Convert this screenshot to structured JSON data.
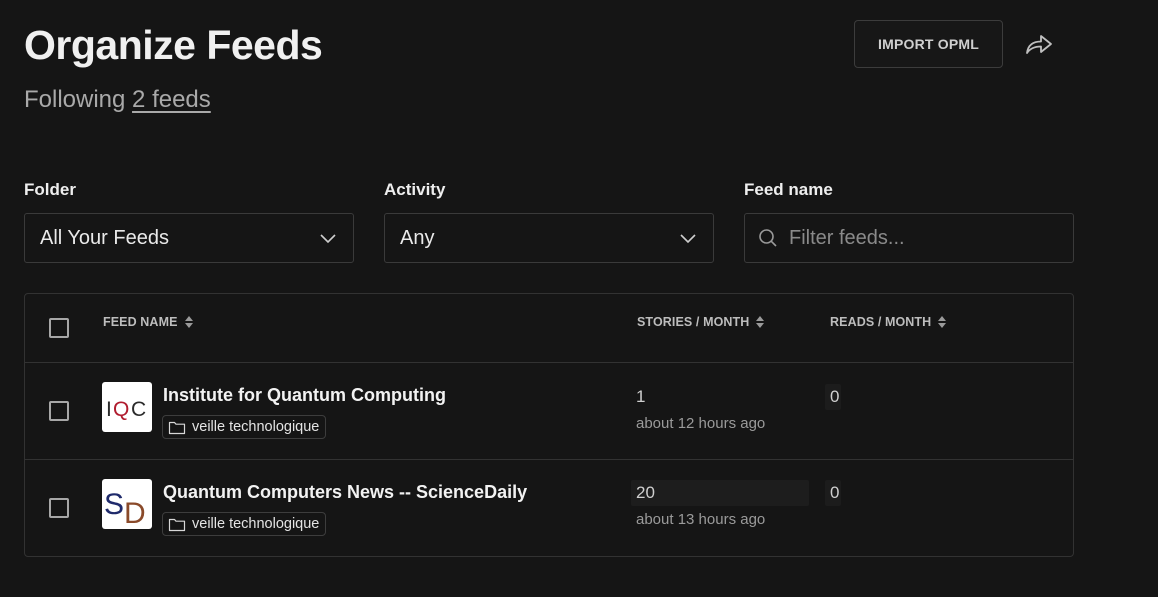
{
  "header": {
    "title": "Organize Feeds",
    "following_prefix": "Following ",
    "following_link": "2 feeds",
    "import_label": "IMPORT OPML",
    "share_icon": "share-icon"
  },
  "filters": {
    "folder": {
      "label": "Folder",
      "value": "All Your Feeds"
    },
    "activity": {
      "label": "Activity",
      "value": "Any"
    },
    "feed_name": {
      "label": "Feed name",
      "placeholder": "Filter feeds...",
      "value": ""
    }
  },
  "table": {
    "columns": {
      "feed_name": "FEED NAME",
      "stories": "STORIES / MONTH",
      "reads": "READS / MONTH"
    },
    "rows": [
      {
        "name": "Institute for Quantum Computing",
        "folder": "veille technologique",
        "stories": "1",
        "last_story": "about 12 hours ago",
        "reads": "0",
        "logo_icon": "iqc-logo"
      },
      {
        "name": "Quantum Computers News -- ScienceDaily",
        "folder": "veille technologique",
        "stories": "20",
        "last_story": "about 13 hours ago",
        "reads": "0",
        "logo_icon": "sd-logo"
      }
    ]
  },
  "colors": {
    "background": "#151515",
    "border": "#323232",
    "text": "#e8e8e8",
    "muted": "#9a9a9a"
  }
}
